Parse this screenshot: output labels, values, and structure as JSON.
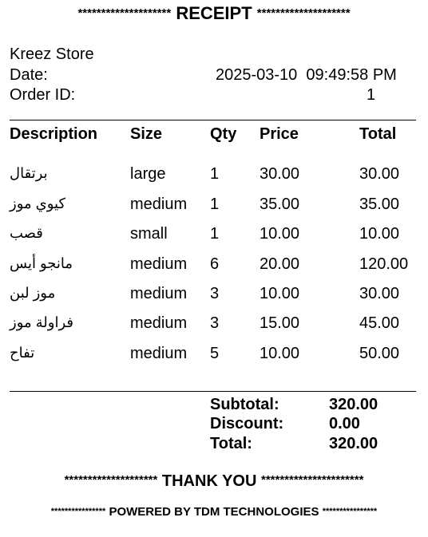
{
  "header": {
    "stars_left": "********************",
    "title": "RECEIPT",
    "stars_right": "********************"
  },
  "store": {
    "name": "Kreez Store",
    "date_label": "Date:",
    "date_value": "2025-03-10  09:49:58 PM",
    "order_label": "Order ID:",
    "order_value": "1"
  },
  "table": {
    "columns": [
      "Description",
      "Size",
      "Qty",
      "Price",
      "Total"
    ],
    "rows": [
      {
        "description": "برتقال",
        "size": "large",
        "qty": "1",
        "price": "30.00",
        "total": "30.00"
      },
      {
        "description": "كيوي موز",
        "size": "medium",
        "qty": "1",
        "price": "35.00",
        "total": "35.00"
      },
      {
        "description": "قصب",
        "size": "small",
        "qty": "1",
        "price": "10.00",
        "total": "10.00"
      },
      {
        "description": "مانجو أيس",
        "size": "medium",
        "qty": "6",
        "price": "20.00",
        "total": "120.00"
      },
      {
        "description": "موز لبن",
        "size": "medium",
        "qty": "3",
        "price": "10.00",
        "total": "30.00"
      },
      {
        "description": "فراولة موز",
        "size": "medium",
        "qty": "3",
        "price": "15.00",
        "total": "45.00"
      },
      {
        "description": "تفاح",
        "size": "medium",
        "qty": "5",
        "price": "10.00",
        "total": "50.00"
      }
    ]
  },
  "summary": {
    "subtotal_label": "Subtotal:",
    "subtotal_value": "320.00",
    "discount_label": "Discount:",
    "discount_value": "0.00",
    "total_label": "Total:",
    "total_value": "320.00"
  },
  "footer": {
    "thanks_stars_left": "********************",
    "thanks": "THANK YOU",
    "thanks_stars_right": "**********************",
    "powered_stars_left": "****************",
    "powered": "POWERED BY TDM TECHNOLOGIES",
    "powered_stars_right": "****************"
  }
}
